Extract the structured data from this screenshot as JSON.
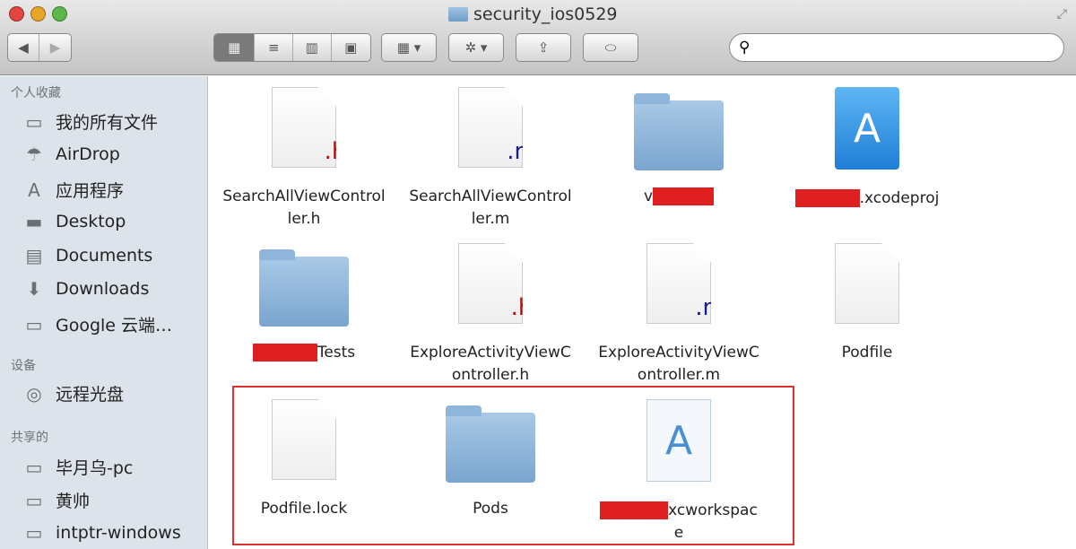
{
  "window": {
    "title": "security_ios0529"
  },
  "toolbar": {
    "back": "◀",
    "forward": "▶",
    "view_icon": "▦",
    "view_list": "≡",
    "view_column": "▥",
    "view_coverflow": "▣",
    "arrange": "▦ ▾",
    "action": "✲ ▾",
    "share": "⇪",
    "tag": "⬭",
    "search_icon": "⚲",
    "search_placeholder": ""
  },
  "sidebar": {
    "sections": [
      {
        "title": "个人收藏",
        "items": [
          {
            "label": "我的所有文件",
            "icon": "▭"
          },
          {
            "label": "AirDrop",
            "icon": "☂"
          },
          {
            "label": "应用程序",
            "icon": "A"
          },
          {
            "label": "Desktop",
            "icon": "▬"
          },
          {
            "label": "Documents",
            "icon": "▤"
          },
          {
            "label": "Downloads",
            "icon": "⬇"
          },
          {
            "label": "Google 云端…",
            "icon": "▭"
          }
        ]
      },
      {
        "title": "设备",
        "items": [
          {
            "label": "远程光盘",
            "icon": "◎"
          }
        ]
      },
      {
        "title": "共享的",
        "items": [
          {
            "label": "毕月乌-pc",
            "icon": "▭"
          },
          {
            "label": "黄帅",
            "icon": "▭"
          },
          {
            "label": "intptr-windows",
            "icon": "▭"
          }
        ]
      }
    ]
  },
  "files": [
    {
      "pre": "",
      "post": "SearchAllViewController.h",
      "type": "h",
      "ext": ".h"
    },
    {
      "pre": "",
      "post": "SearchAllViewController.m",
      "type": "m",
      "ext": ".m"
    },
    {
      "pre": "v",
      "post": "",
      "type": "folder",
      "redacted": true
    },
    {
      "pre": "",
      "post": ".xcodeproj",
      "type": "xcodeproj",
      "redacted": true
    },
    {
      "pre": "",
      "post": "Tests",
      "type": "folder",
      "redacted": true
    },
    {
      "pre": "",
      "post": "ExploreActivityViewController.h",
      "type": "h",
      "ext": ".h"
    },
    {
      "pre": "",
      "post": "ExploreActivityViewController.m",
      "type": "m",
      "ext": ".m"
    },
    {
      "pre": "",
      "post": "Podfile",
      "type": "doc"
    },
    {
      "pre": "",
      "post": "Podfile.lock",
      "type": "doc"
    },
    {
      "pre": "",
      "post": "Pods",
      "type": "folder"
    },
    {
      "pre": "",
      "post": "xcworkspace",
      "type": "xcworkspace",
      "redacted": true
    }
  ],
  "colors": {
    "highlight": "#e03030",
    "redaction": "#e02020",
    "h_ext": "#b01010",
    "m_ext": "#1a1a8a"
  }
}
